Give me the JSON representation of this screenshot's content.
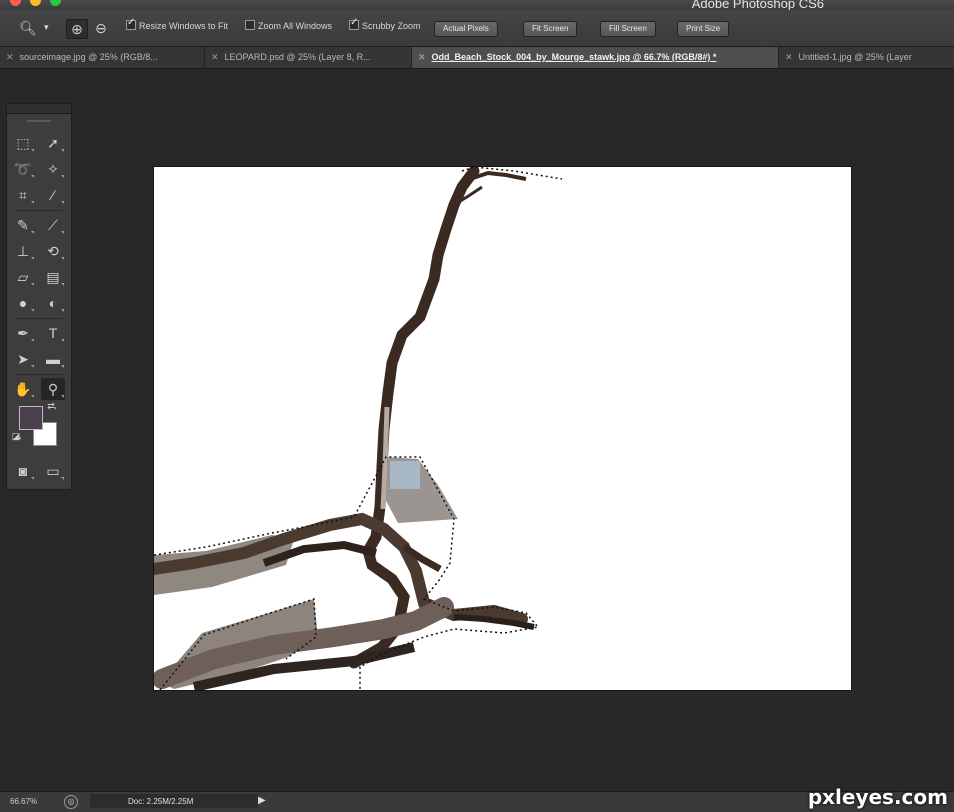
{
  "app": {
    "title": "Adobe Photoshop CS6"
  },
  "colors": {
    "close": "#fd5f57",
    "minimize": "#fdbc2e",
    "zoom": "#27c93f",
    "fg_swatch": "#4a3f4c",
    "bg_swatch": "#ffffff",
    "tab_active": "#4e4e4e"
  },
  "options_bar": {
    "tool_icon": "zoom-icon",
    "zoom_in_icon": "zoom-in-icon",
    "zoom_out_icon": "zoom-out-icon",
    "resize_windows": {
      "label": "Resize Windows to Fit",
      "checked": true
    },
    "zoom_all": {
      "label": "Zoom All Windows",
      "checked": false
    },
    "scrubby_zoom": {
      "label": "Scrubby Zoom",
      "checked": true
    },
    "buttons": {
      "actual_pixels": "Actual Pixels",
      "fit_screen": "Fit Screen",
      "fill_screen": "Fill Screen",
      "print_size": "Print Size"
    }
  },
  "tabs": [
    {
      "label": "sourceimage.jpg @ 25% (RGB/8...",
      "active": false
    },
    {
      "label": "LEOPARD.psd @ 25% (Layer 8, R...",
      "active": false
    },
    {
      "label": "Odd_Beach_Stock_004_by_Mourge_stawk.jpg @ 66.7% (RGB/8#) *",
      "active": true
    },
    {
      "label": "Untitled-1.jpg @ 25% (Layer",
      "active": false
    }
  ],
  "tools": [
    "rectangular-marquee-icon",
    "move-icon",
    "lasso-icon",
    "magic-wand-icon",
    "crop-icon",
    "eyedropper-icon",
    "healing-brush-icon",
    "brush-icon",
    "clone-stamp-icon",
    "history-brush-icon",
    "eraser-icon",
    "gradient-icon",
    "blur-icon",
    "dodge-icon",
    "pen-icon",
    "type-icon",
    "path-selection-icon",
    "rectangle-shape-icon",
    "hand-icon",
    "zoom-icon",
    "quick-mask-icon",
    "screen-mode-icon"
  ],
  "status": {
    "zoom": "66.67%",
    "doc": "Doc: 2.25M/2.25M"
  },
  "watermark": "pxleyes.com"
}
